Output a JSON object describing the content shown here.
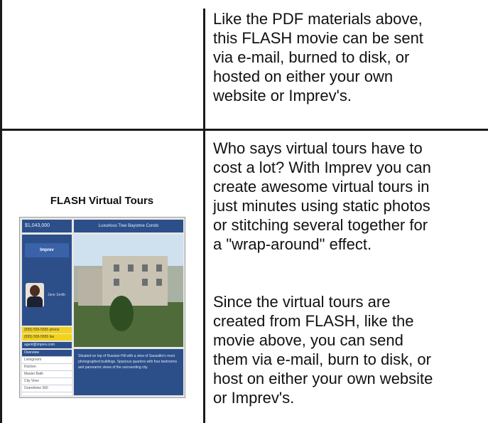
{
  "rows": [
    {
      "paragraphs": [
        [
          "Like the PDF materials above,",
          "this FLASH movie can be sent",
          "via e-mail, burned to disk, or",
          "hosted on either your own",
          "website or Imprev's."
        ]
      ]
    },
    {
      "caption": "FLASH Virtual Tours",
      "paragraphs": [
        [
          "Who says virtual tours have to",
          "cost a lot?  With Imprev you can",
          "create awesome virtual tours in",
          "just minutes using static photos",
          "or stitching several together for",
          "a \"wrap-around\" effect."
        ],
        [
          "Since the virtual tours are",
          "created from FLASH, like the",
          "movie above, you can send",
          "them via e-mail, burn to disk, or",
          "host on either your own website",
          "or Imprev's."
        ]
      ]
    }
  ],
  "thumbnail": {
    "price": "$1,043,000",
    "headline": "Luxurious Tree Bayonne Condo",
    "logo": "Imprev",
    "agent_name": "Jane Smith",
    "phone_1": "(555) 555-5555 phone",
    "phone_2": "(555) 555-5555 fax",
    "email": "agent@imprev.com",
    "menu": [
      "Overview",
      "Livingroom",
      "Kitchen",
      "Master Bath",
      "City View",
      "Grandview 360"
    ],
    "description": "Situated on top of Russian Hill with a view of Sausalito's most photographed buildings. Spacious quarters with four bedrooms and panoramic views of the surrounding city."
  },
  "colors": {
    "panel_blue": "#2c4f8a",
    "phone_yellow": "#f3d11d"
  }
}
